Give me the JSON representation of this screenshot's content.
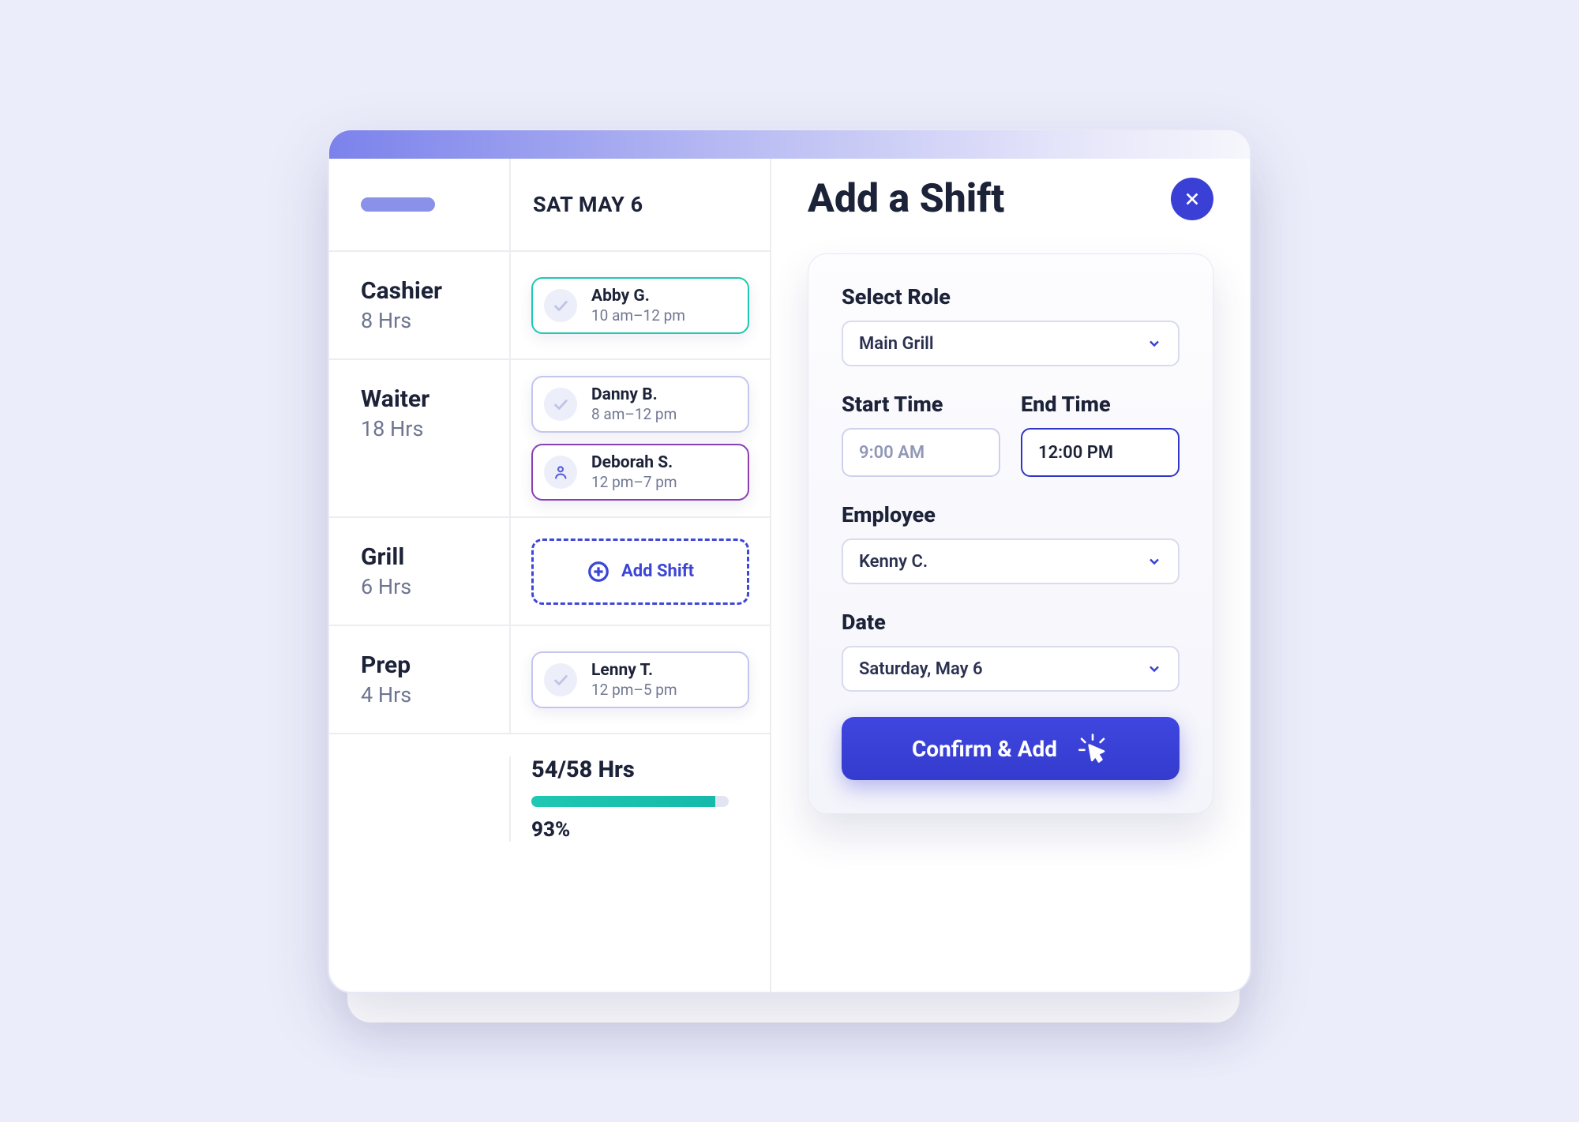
{
  "header": {
    "date": "SAT MAY 6"
  },
  "roles": [
    {
      "name": "Cashier",
      "hours": "8 Hrs",
      "shifts": [
        {
          "name": "Abby G.",
          "time": "10 am–12 pm",
          "style": "teal",
          "icon": "check"
        }
      ]
    },
    {
      "name": "Waiter",
      "hours": "18 Hrs",
      "shifts": [
        {
          "name": "Danny B.",
          "time": "8 am–12 pm",
          "style": "lilac",
          "icon": "check"
        },
        {
          "name": "Deborah S.",
          "time": "12 pm–7 pm",
          "style": "purple",
          "icon": "person"
        }
      ]
    },
    {
      "name": "Grill",
      "hours": "6 Hrs",
      "shifts": [],
      "addShiftLabel": "Add Shift"
    },
    {
      "name": "Prep",
      "hours": "4 Hrs",
      "shifts": [
        {
          "name": "Lenny T.",
          "time": "12 pm–5 pm",
          "style": "lilac",
          "icon": "check"
        }
      ]
    }
  ],
  "summary": {
    "hours": "54/58 Hrs",
    "percentLabel": "93%",
    "percentNum": 93
  },
  "panel": {
    "title": "Add a Shift",
    "roleLabel": "Select Role",
    "roleValue": "Main Grill",
    "startLabel": "Start Time",
    "startValue": "9:00 AM",
    "endLabel": "End Time",
    "endValue": "12:00 PM",
    "employeeLabel": "Employee",
    "employeeValue": "Kenny C.",
    "dateLabel": "Date",
    "dateValue": "Saturday, May 6",
    "confirmLabel": "Confirm & Add"
  }
}
